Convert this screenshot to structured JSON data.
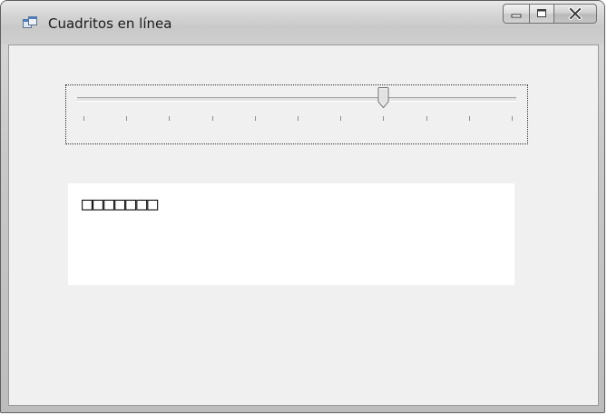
{
  "window": {
    "title": "Cuadritos en línea",
    "icon": "app-form-icon",
    "caption_buttons": [
      "minimize-icon",
      "maximize-icon",
      "close-icon"
    ]
  },
  "trackbar": {
    "minimum": 0,
    "maximum": 10,
    "value": 7,
    "tick_count": 11
  },
  "output": {
    "text": "□□□□□□□"
  }
}
